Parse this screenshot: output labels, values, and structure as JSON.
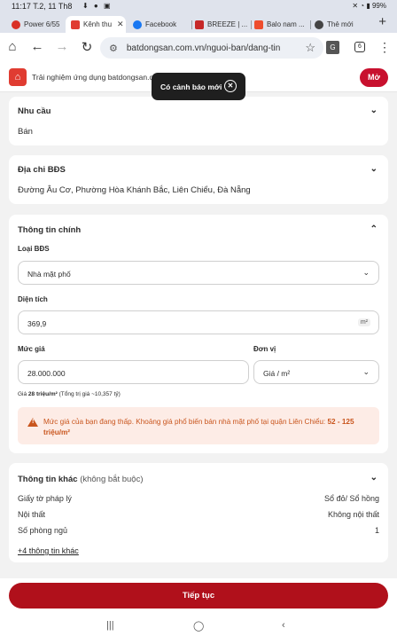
{
  "status_bar": {
    "time": "11:17",
    "date": "T.2, 11 Th8",
    "battery": "99%"
  },
  "tabs": [
    {
      "label": "Power 6/55",
      "favicon": "power-favicon",
      "color": "#d93025"
    },
    {
      "label": "Kênh thu",
      "favicon": "bds-favicon",
      "color": "#e03c31",
      "active": true
    },
    {
      "label": "Facebook",
      "favicon": "facebook-favicon",
      "color": "#1877f2"
    },
    {
      "label": "BREEZE | ...",
      "favicon": "breeze-favicon",
      "color": "#c62828"
    },
    {
      "label": "Balo nam ...",
      "favicon": "balo-favicon",
      "color": "#ee4d2d"
    },
    {
      "label": "Thẻ mới",
      "favicon": "newtab-favicon",
      "color": "#444444"
    }
  ],
  "toolbar": {
    "url": "batdongsan.com.vn/nguoi-ban/dang-tin",
    "tab_count": "6"
  },
  "app_banner": {
    "text": "Trải nghiệm ứng dụng batdongsan.c",
    "open_label": "Mở"
  },
  "toast": {
    "text": "Có cảnh báo mới"
  },
  "need": {
    "title": "Nhu cầu",
    "value": "Bán"
  },
  "address": {
    "title": "Địa chỉ BĐS",
    "value": "Đường Âu Cơ, Phường Hòa Khánh Bắc, Liên Chiểu, Đà Nẵng"
  },
  "main_info": {
    "title": "Thông tin chính",
    "type_label": "Loại BĐS",
    "type_value": "Nhà mặt phố",
    "area_label": "Diện tích",
    "area_value": "369,9",
    "area_unit": "m²",
    "price_label": "Mức giá",
    "price_value": "28.000.000",
    "unit_label": "Đơn vị",
    "unit_value": "Giá / m²",
    "price_note_prefix": "Giá ",
    "price_note_bold": "28 triệu/m²",
    "price_note_suffix": " (Tổng trị giá ~10,357 tỷ)",
    "warning_text": "Mức giá của bạn đang thấp. Khoảng giá phổ biến bán nhà mặt phố tại quận Liên Chiểu: ",
    "warning_bold": "52 - 125 triệu/m²",
    "warning_color": "#c9551d"
  },
  "other_info": {
    "title": "Thông tin khác",
    "optional": "(không bắt buộc)",
    "rows": [
      {
        "key": "Giấy tờ pháp lý",
        "value": "Sổ đỏ/ Sổ hồng"
      },
      {
        "key": "Nội thất",
        "value": "Không nội thất"
      },
      {
        "key": "Số phòng ngủ",
        "value": "1"
      }
    ],
    "more_link": "+4 thông tin khác"
  },
  "continue_label": "Tiếp tục",
  "colors": {
    "primary": "#b0101b",
    "brand": "#e03c31"
  }
}
